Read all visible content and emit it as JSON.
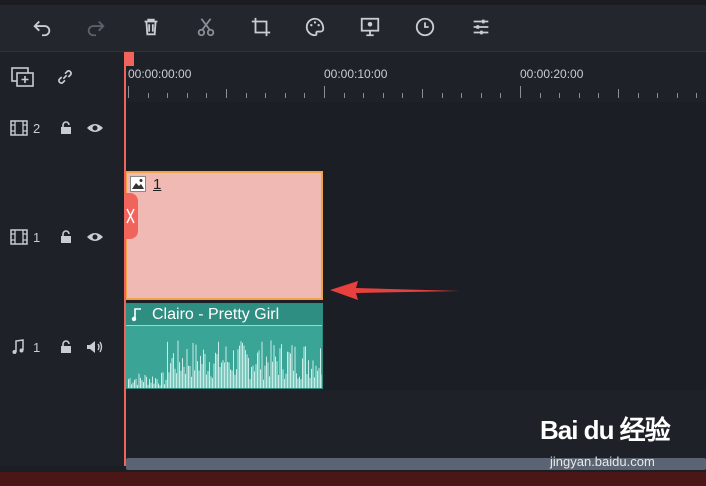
{
  "toolbar": {
    "buttons": [
      {
        "name": "undo",
        "icon": "undo-icon"
      },
      {
        "name": "redo",
        "icon": "redo-icon"
      },
      {
        "name": "delete",
        "icon": "trash-icon"
      },
      {
        "name": "cut",
        "icon": "scissors-icon"
      },
      {
        "name": "crop",
        "icon": "crop-icon"
      },
      {
        "name": "color",
        "icon": "palette-icon"
      },
      {
        "name": "presentation",
        "icon": "presentation-icon"
      },
      {
        "name": "speed",
        "icon": "clock-icon"
      },
      {
        "name": "adjust",
        "icon": "sliders-icon"
      }
    ]
  },
  "timeline": {
    "time_labels": [
      "00:00:00:00",
      "00:00:10:00",
      "00:00:20:00"
    ]
  },
  "tracks": [
    {
      "type": "video",
      "label": "2",
      "icons": [
        "film-icon",
        "lock-icon",
        "eye-icon"
      ]
    },
    {
      "type": "video",
      "label": "1",
      "icons": [
        "film-icon",
        "lock-icon",
        "eye-icon"
      ]
    },
    {
      "type": "audio",
      "label": "1",
      "icons": [
        "music-note-icon",
        "lock-icon",
        "speaker-icon"
      ]
    }
  ],
  "clips": {
    "video": {
      "label": "1",
      "icon": "image-icon"
    },
    "audio": {
      "title": "Clairo - Pretty Girl",
      "icon": "music-note-icon"
    }
  },
  "watermark": {
    "logo": "Bai du 经验",
    "url": "jingyan.baidu.com"
  },
  "colors": {
    "accent": "#f0645c",
    "video_clip": "#f0b9b4",
    "audio_clip": "#3aa597",
    "selection": "#f0a34a",
    "arrow": "#e8403f"
  }
}
